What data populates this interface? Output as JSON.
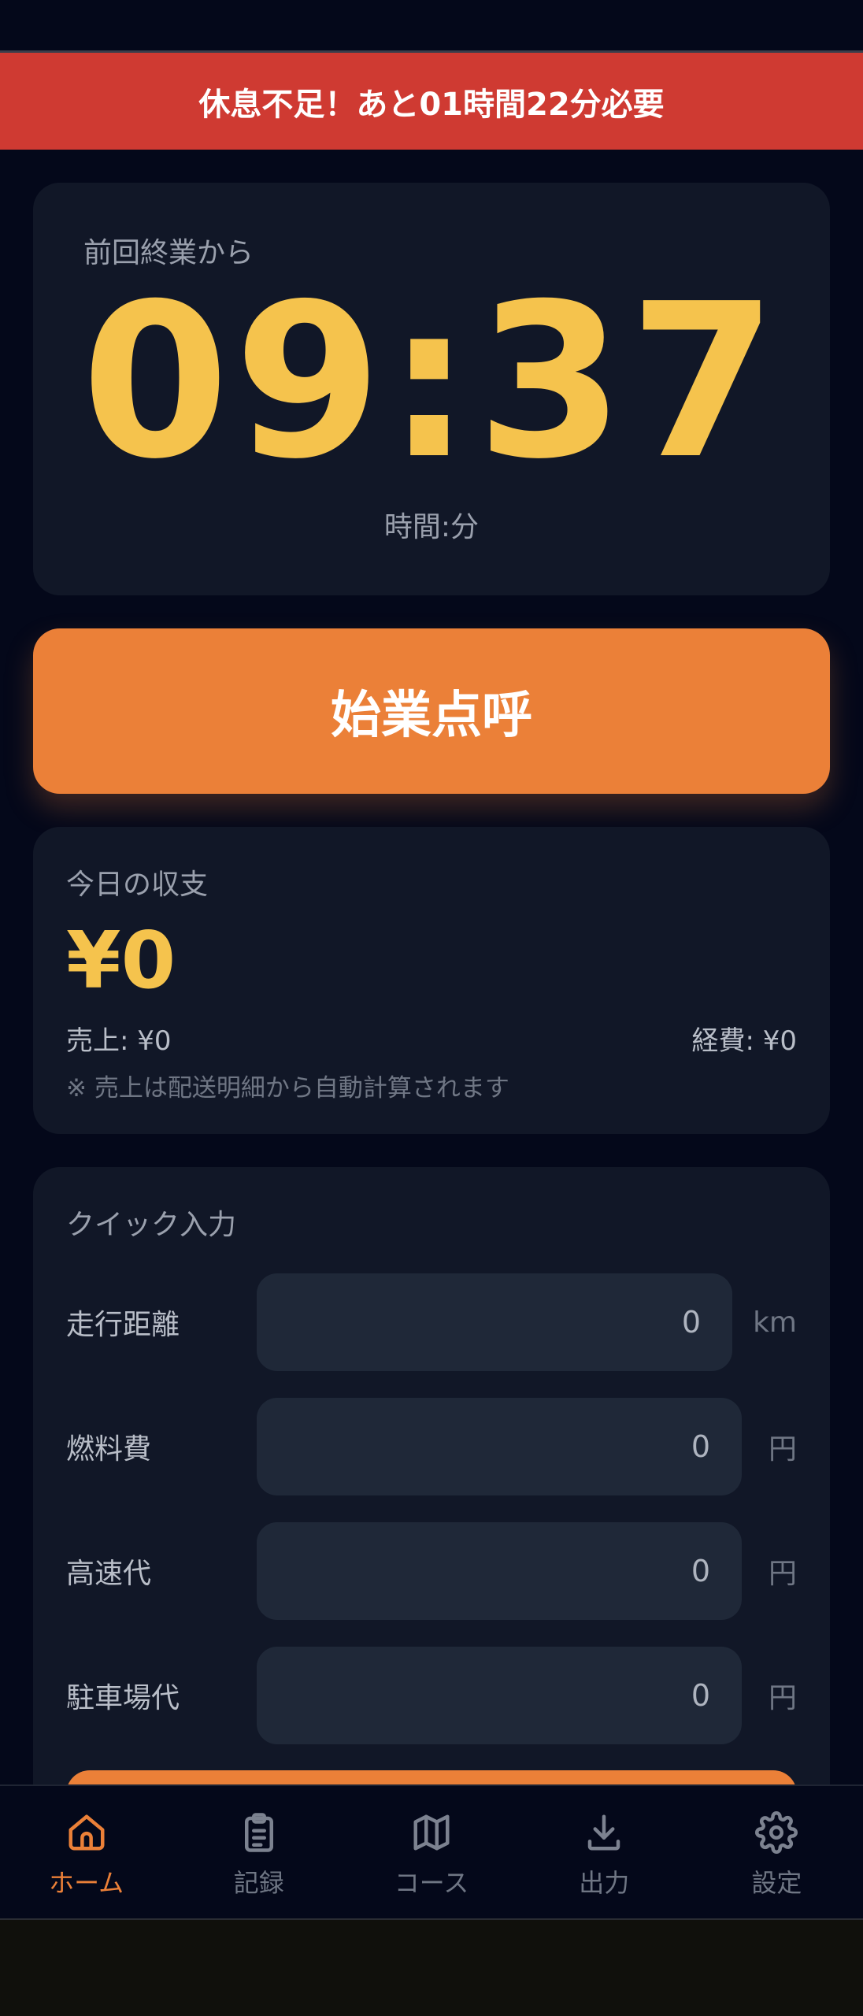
{
  "alert": {
    "text": "休息不足！あと01時間22分必要"
  },
  "timer": {
    "label": "前回終業から",
    "value": "09:37",
    "unit": "時間:分"
  },
  "start_button": {
    "label": "始業点呼"
  },
  "income": {
    "title": "今日の収支",
    "total": "¥0",
    "sales": "売上: ¥0",
    "expense": "経費: ¥0",
    "note": "※ 売上は配送明細から自動計算されます"
  },
  "quick_input": {
    "title": "クイック入力",
    "rows": [
      {
        "label": "走行距離",
        "value": "0",
        "unit": "km"
      },
      {
        "label": "燃料費",
        "value": "0",
        "unit": "円"
      },
      {
        "label": "高速代",
        "value": "0",
        "unit": "円"
      },
      {
        "label": "駐車場代",
        "value": "0",
        "unit": "円"
      }
    ]
  },
  "nav": {
    "items": [
      {
        "label": "ホーム",
        "icon": "home-icon",
        "active": true
      },
      {
        "label": "記録",
        "icon": "clipboard-icon",
        "active": false
      },
      {
        "label": "コース",
        "icon": "map-icon",
        "active": false
      },
      {
        "label": "出力",
        "icon": "download-icon",
        "active": false
      },
      {
        "label": "設定",
        "icon": "gear-icon",
        "active": false
      }
    ]
  },
  "colors": {
    "background": "#04081a",
    "card": "#111727",
    "accent_orange": "#eb8038",
    "accent_yellow": "#f5c34d",
    "alert_red": "#cf3a32",
    "input_bg": "#1f2838"
  }
}
